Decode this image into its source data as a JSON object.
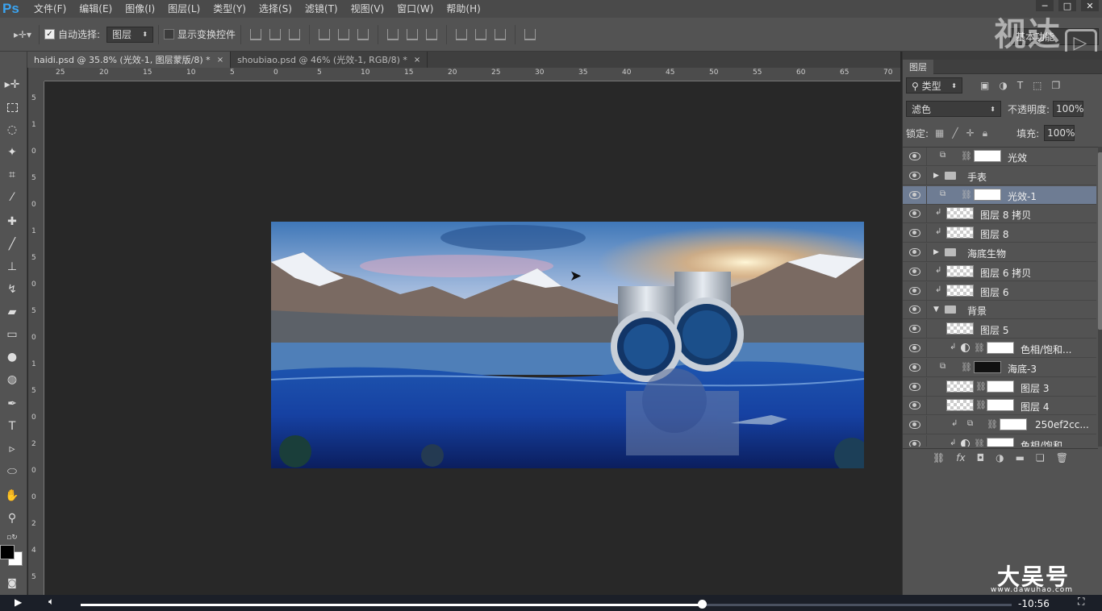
{
  "app": {
    "logo": "Ps"
  },
  "menu": [
    "文件(F)",
    "编辑(E)",
    "图像(I)",
    "图层(L)",
    "类型(Y)",
    "选择(S)",
    "滤镜(T)",
    "视图(V)",
    "窗口(W)",
    "帮助(H)"
  ],
  "watermark_top": "视达",
  "options": {
    "auto_select_label": "自动选择:",
    "auto_select_value": "图层",
    "show_transform_label": "显示变换控件",
    "workspace": "基本功能"
  },
  "tabs": [
    {
      "label": "haidi.psd @ 35.8% (光效-1, 图层蒙版/8) *",
      "close": "×"
    },
    {
      "label": "shoubiao.psd @ 46% (光效-1, RGB/8) *",
      "close": "×"
    }
  ],
  "ruler_top": [
    "25",
    "20",
    "15",
    "10",
    "5",
    "0",
    "5",
    "10",
    "15",
    "20",
    "25",
    "30",
    "35",
    "40",
    "45",
    "50",
    "55",
    "60",
    "65",
    "70"
  ],
  "ruler_left": [
    "5",
    "1",
    "0",
    "5",
    "0",
    "1",
    "5",
    "0",
    "5",
    "0",
    "1",
    "5",
    "0",
    "2",
    "0",
    "0",
    "2",
    "4",
    "5"
  ],
  "panel": {
    "tab": "图层",
    "filter_kind": "类型",
    "blend_mode": "滤色",
    "opacity_label": "不透明度:",
    "opacity_value": "100%",
    "lock_label": "锁定:",
    "fill_label": "填充:",
    "fill_value": "100%",
    "layers": [
      {
        "name": "光效",
        "type": "smart-mask",
        "selected": false
      },
      {
        "name": "手表",
        "type": "group",
        "selected": false
      },
      {
        "name": "光效-1",
        "type": "smart-mask",
        "selected": true
      },
      {
        "name": "图层 8 拷贝",
        "type": "clip-layer",
        "selected": false
      },
      {
        "name": "图层 8",
        "type": "clip-layer",
        "selected": false
      },
      {
        "name": "海底生物",
        "type": "group",
        "selected": false
      },
      {
        "name": "图层 6 拷贝",
        "type": "clip-layer",
        "selected": false
      },
      {
        "name": "图层 6",
        "type": "clip-layer",
        "selected": false
      },
      {
        "name": "背景",
        "type": "group-open",
        "selected": false
      },
      {
        "name": "图层 5",
        "type": "layer",
        "selected": false
      },
      {
        "name": "色相/饱和...",
        "type": "adjust",
        "selected": false
      },
      {
        "name": "海底-3",
        "type": "smart-mask-black",
        "selected": false
      },
      {
        "name": "图层 3",
        "type": "layer-mask",
        "selected": false
      },
      {
        "name": "图层 4",
        "type": "layer-mask",
        "selected": false
      },
      {
        "name": "250ef2cc...",
        "type": "clip-smart",
        "selected": false
      },
      {
        "name": "色相/饱和...",
        "type": "adjust",
        "selected": false
      }
    ]
  },
  "player": {
    "time": "-10:56",
    "progress": 0.668
  },
  "watermark_bottom": "大吴号",
  "watermark_bottom_sub": "www.dawuhao.com"
}
